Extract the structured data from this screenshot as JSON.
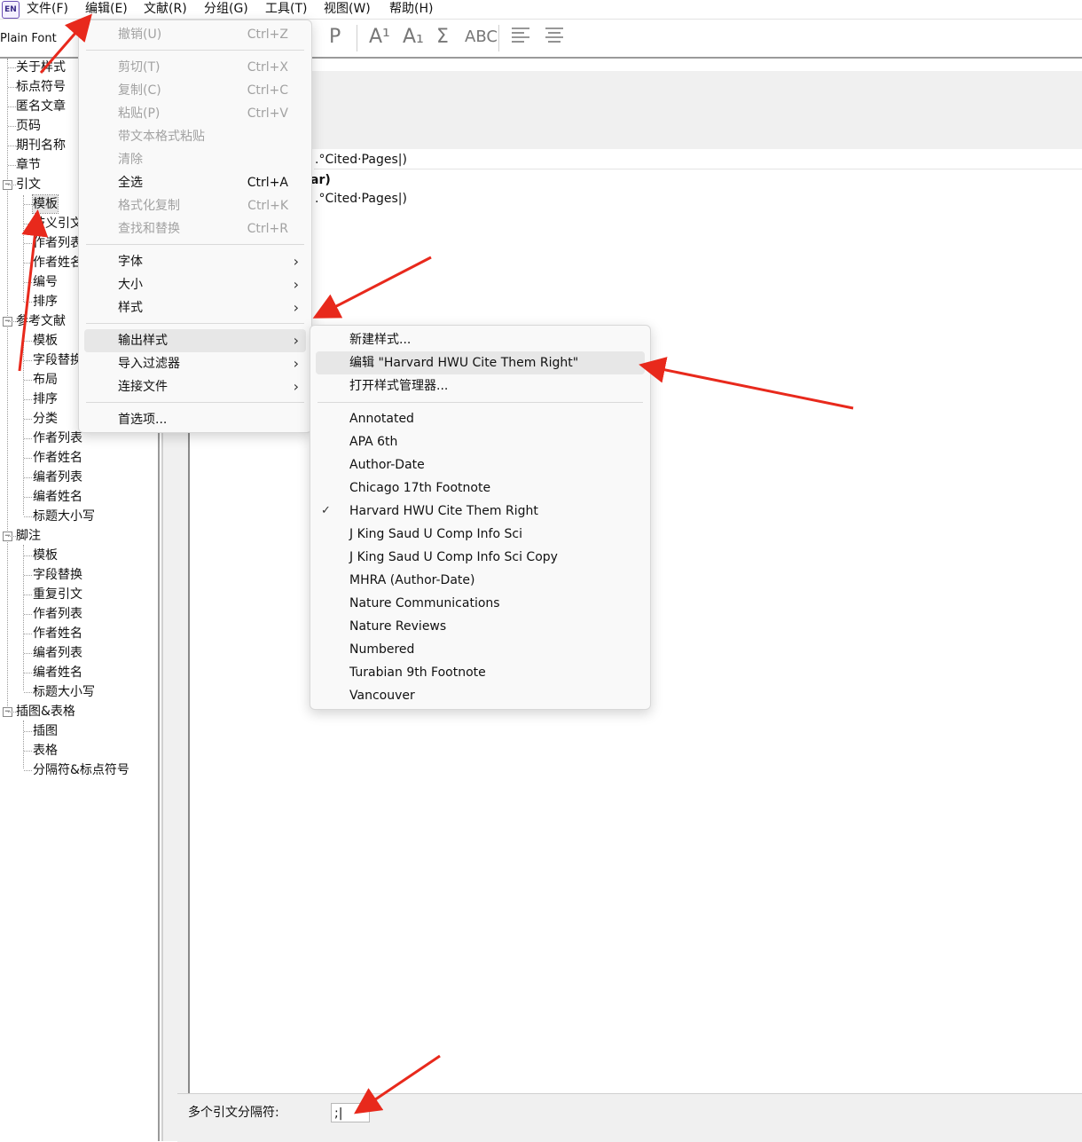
{
  "menubar": {
    "app_icon": "EN",
    "items": [
      "文件(F)",
      "编辑(E)",
      "文献(R)",
      "分组(G)",
      "工具(T)",
      "视图(W)",
      "帮助(H)"
    ]
  },
  "toolbar": {
    "font": "Plain Font",
    "icons": [
      "P",
      "A¹",
      "A₁",
      "Σ",
      "ABC",
      "align-left-icon",
      "align-center-icon"
    ]
  },
  "tree": {
    "items": [
      "关于样式",
      "标点符号",
      "匿名文章",
      "页码",
      "期刊名称",
      "章节",
      "引文",
      "模板",
      "歧义引文",
      "作者列表",
      "作者姓名",
      "编号",
      "排序",
      "参考文献",
      "模板",
      "字段替换",
      "布局",
      "排序",
      "分类",
      "作者列表",
      "作者姓名",
      "编者列表",
      "编者姓名",
      "标题大小写",
      "脚注",
      "模板",
      "字段替换",
      "重复引文",
      "作者列表",
      "作者姓名",
      "编者列表",
      "编者姓名",
      "标题大小写",
      "插图&表格",
      "插图",
      "表格",
      "分隔符&标点符号"
    ]
  },
  "editor": {
    "line1": ".°Cited·Pages|)",
    "line2_bold": "ar)",
    "line3": ".°Cited·Pages|)",
    "separator_label": "多个引文分隔符:",
    "separator_value": ";|"
  },
  "edit_menu": {
    "undo": "撤销(U)",
    "undo_sc": "Ctrl+Z",
    "cut": "剪切(T)",
    "cut_sc": "Ctrl+X",
    "copy": "复制(C)",
    "copy_sc": "Ctrl+C",
    "paste": "粘贴(P)",
    "paste_sc": "Ctrl+V",
    "paste_rich": "带文本格式粘贴",
    "clear": "清除",
    "select_all": "全选",
    "select_all_sc": "Ctrl+A",
    "copy_formatted": "格式化复制",
    "copy_formatted_sc": "Ctrl+K",
    "find_replace": "查找和替换",
    "find_replace_sc": "Ctrl+R",
    "font": "字体",
    "size": "大小",
    "style": "样式",
    "output_styles": "输出样式",
    "import_filters": "导入过滤器",
    "connection_files": "连接文件",
    "preferences": "首选项..."
  },
  "styles_menu": {
    "new_style": "新建样式...",
    "edit_style": "编辑 \"Harvard HWU Cite Them Right\"",
    "open_manager": "打开样式管理器...",
    "styles": [
      "Annotated",
      "APA 6th",
      "Author-Date",
      "Chicago 17th Footnote",
      "Harvard HWU Cite Them Right",
      "J King Saud U Comp Info Sci",
      "J King Saud U Comp Info Sci Copy",
      "MHRA (Author-Date)",
      "Nature Communications",
      "Nature Reviews",
      "Numbered",
      "Turabian 9th Footnote",
      "Vancouver"
    ],
    "checked_style": "Harvard HWU Cite Them Right"
  },
  "colors": {
    "arrow": "#e8291c",
    "menu_bg": "#f9f9f9",
    "highlight": "#e7e7e7",
    "disabled": "#a2a2a2"
  }
}
